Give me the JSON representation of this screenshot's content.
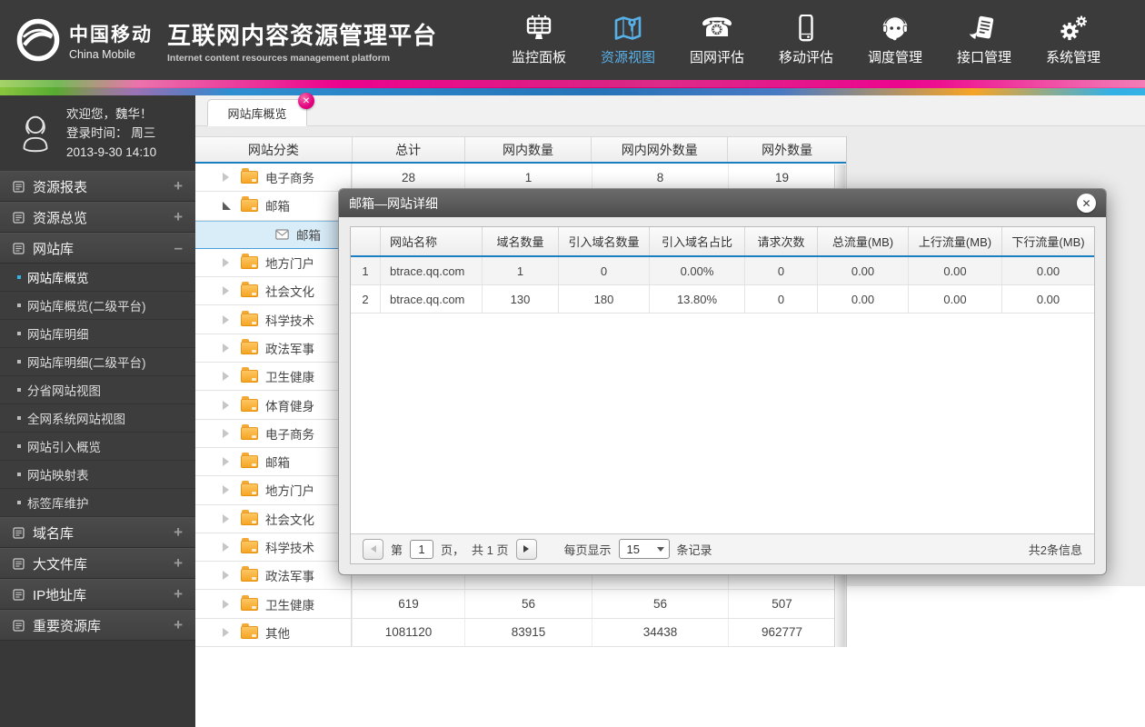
{
  "colors": {
    "header_bg": "#3b3b3b",
    "accent_blue": "#58b0e8",
    "ribbon_pink": "#ec008c",
    "ribbon_green": "#8dc63f",
    "ribbon_blue": "#2e8fd0",
    "ribbon_yellow": "#f6ab20",
    "ribbon_cyan": "#29b6e8",
    "folder_orange": "#f6a21f",
    "selected_row_bg": "#d9edf9",
    "table_header_accent": "#1b7ec2",
    "tab_close_pink": "#e3017f"
  },
  "header": {
    "logo_zh": "中国移动",
    "logo_en": "China Mobile",
    "title": "互联网内容资源管理平台",
    "subtitle": "Internet content resources management platform",
    "nav": [
      {
        "label": "监控面板",
        "icon": "dashboard-icon",
        "active": false
      },
      {
        "label": "资源视图",
        "icon": "map-icon",
        "active": true
      },
      {
        "label": "固网评估",
        "icon": "phone-icon",
        "active": false
      },
      {
        "label": "移动评估",
        "icon": "mobile-icon",
        "active": false
      },
      {
        "label": "调度管理",
        "icon": "headset-icon",
        "active": false
      },
      {
        "label": "接口管理",
        "icon": "interface-doc-icon",
        "active": false
      },
      {
        "label": "系统管理",
        "icon": "gears-icon",
        "active": false
      }
    ]
  },
  "sidebar": {
    "user": {
      "line1": "欢迎您，魏华！",
      "line2": "登录时间：  周三",
      "line3": "2013-9-30  14:10"
    },
    "menu": [
      {
        "label": "资源报表",
        "expand": "+"
      },
      {
        "label": "资源总览",
        "expand": "+"
      },
      {
        "label": "网站库",
        "expand": "–",
        "children": [
          {
            "label": "网站库概览",
            "active": true
          },
          {
            "label": "网站库概览(二级平台)"
          },
          {
            "label": "网站库明细"
          },
          {
            "label": "网站库明细(二级平台)"
          },
          {
            "label": "分省网站视图"
          },
          {
            "label": "全网系统网站视图"
          },
          {
            "label": "网站引入概览"
          },
          {
            "label": "网站映射表"
          },
          {
            "label": "标签库维护"
          }
        ]
      },
      {
        "label": "域名库",
        "expand": "+"
      },
      {
        "label": "大文件库",
        "expand": "+"
      },
      {
        "label": "IP地址库",
        "expand": "+"
      },
      {
        "label": "重要资源库",
        "expand": "+"
      }
    ]
  },
  "tabs": [
    {
      "label": "网站库概览",
      "active": true,
      "closable": true
    }
  ],
  "category_table": {
    "columns": [
      "网站分类",
      "总计",
      "网内数量",
      "网内网外数量",
      "网外数量"
    ],
    "rows": [
      {
        "label": "电子商务",
        "level": 1,
        "node": "collapsed",
        "icon": "folder",
        "values": [
          "28",
          "1",
          "8",
          "19"
        ]
      },
      {
        "label": "邮箱",
        "level": 1,
        "node": "expanded",
        "icon": "folder",
        "values": [
          "",
          "",
          "",
          ""
        ]
      },
      {
        "label": "邮箱",
        "level": 2,
        "node": "leaf",
        "icon": "mail",
        "selected": true,
        "values": [
          "",
          "",
          "",
          ""
        ]
      },
      {
        "label": "地方门户",
        "level": 1,
        "node": "collapsed",
        "icon": "folder",
        "values": [
          "",
          "",
          "",
          ""
        ]
      },
      {
        "label": "社会文化",
        "level": 1,
        "node": "collapsed",
        "icon": "folder",
        "values": [
          "",
          "",
          "",
          ""
        ]
      },
      {
        "label": "科学技术",
        "level": 1,
        "node": "collapsed",
        "icon": "folder",
        "values": [
          "",
          "",
          "",
          ""
        ]
      },
      {
        "label": "政法军事",
        "level": 1,
        "node": "collapsed",
        "icon": "folder",
        "values": [
          "",
          "",
          "",
          ""
        ]
      },
      {
        "label": "卫生健康",
        "level": 1,
        "node": "collapsed",
        "icon": "folder",
        "values": [
          "",
          "",
          "",
          ""
        ]
      },
      {
        "label": "体育健身",
        "level": 1,
        "node": "collapsed",
        "icon": "folder",
        "values": [
          "",
          "",
          "",
          ""
        ]
      },
      {
        "label": "电子商务",
        "level": 1,
        "node": "collapsed",
        "icon": "folder",
        "values": [
          "",
          "",
          "",
          ""
        ]
      },
      {
        "label": "邮箱",
        "level": 1,
        "node": "collapsed",
        "icon": "folder",
        "values": [
          "",
          "",
          "",
          ""
        ]
      },
      {
        "label": "地方门户",
        "level": 1,
        "node": "collapsed",
        "icon": "folder",
        "values": [
          "",
          "",
          "",
          ""
        ]
      },
      {
        "label": "社会文化",
        "level": 1,
        "node": "collapsed",
        "icon": "folder",
        "values": [
          "",
          "",
          "",
          ""
        ]
      },
      {
        "label": "科学技术",
        "level": 1,
        "node": "collapsed",
        "icon": "folder",
        "values": [
          "",
          "",
          "",
          ""
        ]
      },
      {
        "label": "政法军事",
        "level": 1,
        "node": "collapsed",
        "icon": "folder",
        "values": [
          "",
          "",
          "",
          ""
        ]
      },
      {
        "label": "卫生健康",
        "level": 1,
        "node": "collapsed",
        "icon": "folder",
        "values": [
          "619",
          "56",
          "56",
          "507"
        ]
      },
      {
        "label": "其他",
        "level": 1,
        "node": "collapsed",
        "icon": "folder",
        "values": [
          "1081120",
          "83915",
          "34438",
          "962777"
        ]
      }
    ]
  },
  "modal": {
    "title": "邮箱—网站详细",
    "table": {
      "columns": [
        "",
        "网站名称",
        "域名数量",
        "引入域名数量",
        "引入域名占比",
        "请求次数",
        "总流量(MB)",
        "上行流量(MB)",
        "下行流量(MB)"
      ],
      "rows": [
        [
          "1",
          "btrace.qq.com",
          "1",
          "0",
          "0.00%",
          "0",
          "0.00",
          "0.00",
          "0.00"
        ],
        [
          "2",
          "btrace.qq.com",
          "130",
          "180",
          "13.80%",
          "0",
          "0.00",
          "0.00",
          "0.00"
        ]
      ]
    },
    "pagination": {
      "page_prefix": "第",
      "current_page": "1",
      "page_suffix": "页，",
      "total_pages": "共 1 页",
      "per_page_label": "每页显示",
      "per_page_value": "15",
      "per_page_suffix": "条记录",
      "total_info": "共2条信息"
    }
  }
}
